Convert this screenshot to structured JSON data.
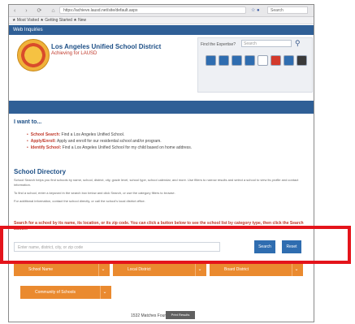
{
  "browser": {
    "nav_icons": "‹ › ⟳ ⌂",
    "url": "https://achieve.lausd.net/site/default.aspx",
    "ext_icons": "☆ ●",
    "search_placeholder": "Search",
    "bookmarks": "★ Most Visited   ★ Getting Started   ★ New"
  },
  "topbar": {
    "label": "Web Inquiries"
  },
  "header": {
    "district_name": "Los Angeles Unified School District",
    "tagline": "Achieving for LAUSD",
    "lookup_label": "Find the Expertise?",
    "lookup_placeholder": "Search",
    "social_colors": [
      "#2f6db0",
      "#2f6db0",
      "#2f6db0",
      "#2f6db0",
      "#ffffff",
      "#d33a2c",
      "#2f6db0",
      "#3a3a3a"
    ]
  },
  "iwant": {
    "title": "I want to...",
    "items": [
      {
        "bold": "School Search:",
        "text": " Find a Los Angeles Unified School."
      },
      {
        "bold": "Apply/Enroll:",
        "text": " Apply and enroll for our residential school and/or program."
      },
      {
        "bold": "Identify School:",
        "text": " Find a Los Angeles Unified School for my child based on home address."
      }
    ]
  },
  "directory": {
    "title": "School Directory",
    "paragraph1": "School Search helps you find schools by name, school, district, city, grade level, school type, school calendar, and more. Use filters to narrow results and select a school to view its profile and contact information.",
    "paragraph2": "To find a school, enter a keyword in the search box below and click Search, or use the category filters to browse.",
    "paragraph3": "For additional information, contact the school directly, or call the school's local district office."
  },
  "instructions": "Search for a school by its name, its location, or its zip code. You can click a button below to see the school list by category type, then click the Search button.",
  "search": {
    "placeholder": "Enter name, district, city, or zip code",
    "search_label": "Search",
    "reset_label": "Reset"
  },
  "filters": [
    {
      "label": "School Name"
    },
    {
      "label": "Local District"
    },
    {
      "label": "Board District"
    },
    {
      "label": "Community of Schools"
    }
  ],
  "results": {
    "text": "1532 Matches Found",
    "button": "Print Results"
  }
}
